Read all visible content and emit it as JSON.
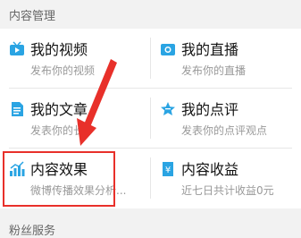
{
  "section": {
    "title": "内容管理"
  },
  "items": [
    {
      "title": "我的视频",
      "subtitle": "发布你的视频",
      "icon": "video-icon",
      "color": "#2aa4e3"
    },
    {
      "title": "我的直播",
      "subtitle": "发布你的直播",
      "icon": "camera-icon",
      "color": "#2aa4e3"
    },
    {
      "title": "我的文章",
      "subtitle": "发表你的长",
      "icon": "document-icon",
      "color": "#2aa4e3"
    },
    {
      "title": "我的点评",
      "subtitle": "发表你的点评观点",
      "icon": "star-comment-icon",
      "color": "#2aa4e3"
    },
    {
      "title": "内容效果",
      "subtitle": "微博传播效果分析...",
      "icon": "bar-chart-icon",
      "color": "#2aa4e3"
    },
    {
      "title": "内容收益",
      "subtitle": "近七日共计收益0元",
      "icon": "income-icon",
      "color": "#2aa4e3"
    }
  ],
  "next_section": {
    "title": "粉丝服务"
  },
  "annotation": {
    "color": "#e8302a"
  }
}
